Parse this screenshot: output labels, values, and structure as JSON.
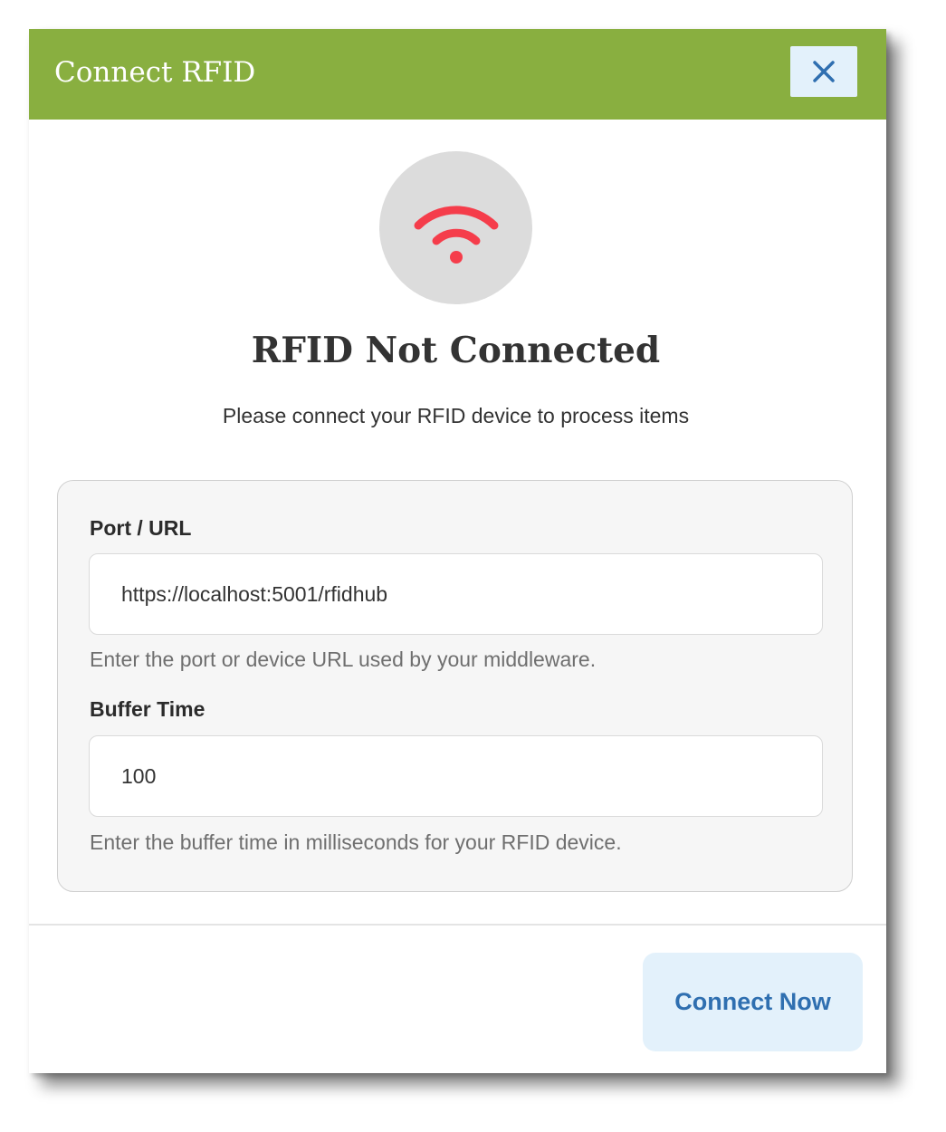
{
  "dialog": {
    "title": "Connect RFID",
    "close_icon": "close-icon",
    "header_color": "#89AF40"
  },
  "status": {
    "icon": "wifi-icon",
    "icon_color": "#F53D4B",
    "title": "RFID Not Connected",
    "subtitle": "Please connect your RFID device to process items"
  },
  "form": {
    "port": {
      "label": "Port / URL",
      "value": "https://localhost:5001/rfidhub",
      "help": "Enter the port or device URL used by your middleware."
    },
    "buffer": {
      "label": "Buffer Time",
      "value": "100",
      "help": "Enter the buffer time in milliseconds for your RFID device."
    }
  },
  "footer": {
    "connect_label": "Connect Now",
    "accent_color": "#2F6FB0"
  }
}
